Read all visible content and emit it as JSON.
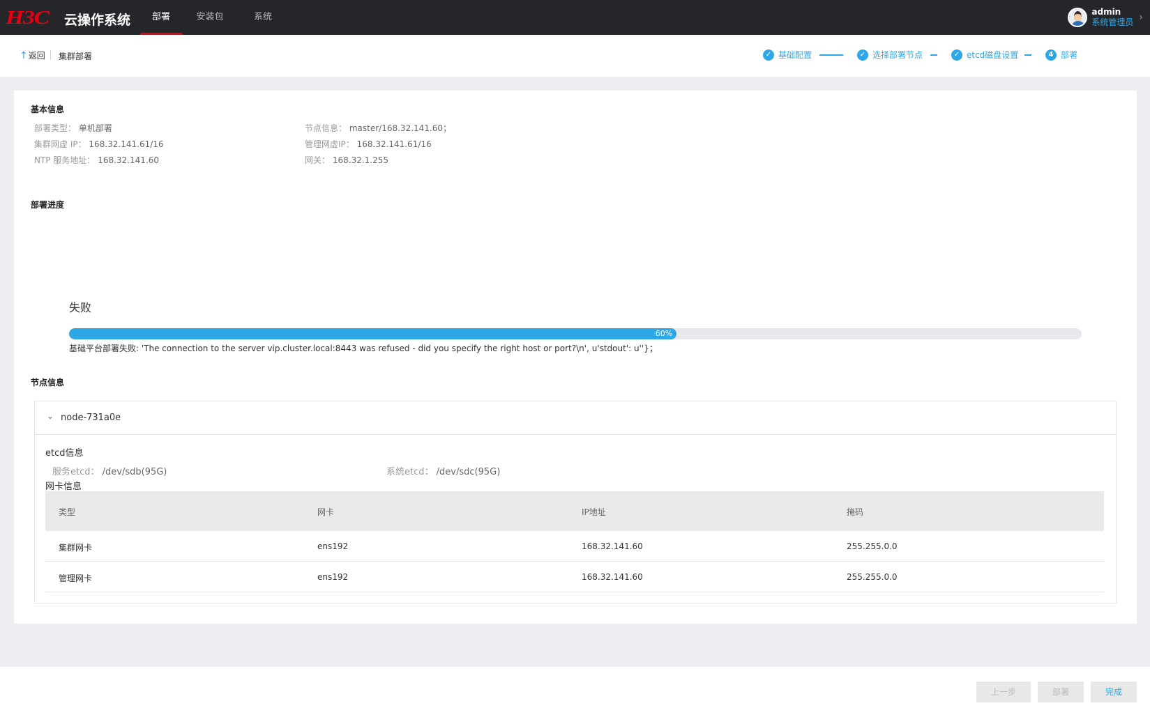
{
  "app": {
    "logo_text": "H3C",
    "product_name": "云操作系统"
  },
  "nav": {
    "tabs": [
      {
        "label": "部署",
        "active": true
      },
      {
        "label": "安装包",
        "active": false
      },
      {
        "label": "系统",
        "active": false
      }
    ]
  },
  "user": {
    "name": "admin",
    "role": "系统管理员"
  },
  "subheader": {
    "back_label": "返回",
    "breadcrumb": "集群部署",
    "steps": [
      {
        "label": "基础配置",
        "status": "done",
        "icon": "check-icon"
      },
      {
        "label": "选择部署节点",
        "status": "done",
        "icon": "check-icon"
      },
      {
        "label": "etcd磁盘设置",
        "status": "done",
        "icon": "check-icon"
      },
      {
        "label": "部署",
        "status": "current",
        "number": "4"
      }
    ]
  },
  "basic_info": {
    "title": "基本信息",
    "deploy_type": {
      "label": "部署类型：",
      "value": "单机部署"
    },
    "cluster_vip": {
      "label": "集群网虚 IP：",
      "value": "168.32.141.61/16"
    },
    "ntp": {
      "label": "NTP 服务地址：",
      "value": "168.32.141.60"
    },
    "node_info": {
      "label": "节点信息：",
      "value": "master/168.32.141.60；"
    },
    "mgmt_vip": {
      "label": "管理网虚IP：",
      "value": "168.32.141.61/16"
    },
    "gateway": {
      "label": "网关：",
      "value": "168.32.1.255"
    }
  },
  "progress": {
    "title": "部署进度",
    "status": "失败",
    "percent": 60,
    "percent_label": "60%",
    "message": "基础平台部署失败: 'The connection to the server vip.cluster.local:8443 was refused - did you specify the right host or port?\\n', u'stdout': u''}；"
  },
  "node_info": {
    "title": "节点信息",
    "node_name": "node-731a0e",
    "etcd_title": "etcd信息",
    "service_etcd": {
      "label": "服务etcd：",
      "value": "/dev/sdb(95G)"
    },
    "system_etcd": {
      "label": "系统etcd：",
      "value": "/dev/sdc(95G)"
    },
    "nic_title": "网卡信息",
    "columns": [
      "类型",
      "网卡",
      "IP地址",
      "掩码"
    ],
    "rows": [
      [
        "集群网卡",
        "ens192",
        "168.32.141.60",
        "255.255.0.0"
      ],
      [
        "管理网卡",
        "ens192",
        "168.32.141.60",
        "255.255.0.0"
      ]
    ]
  },
  "footer": {
    "prev_label": "上一步",
    "deploy_label": "部署",
    "finish_label": "完成"
  },
  "colors": {
    "accent": "#2ea7e6",
    "brand_red": "#e60012",
    "topbar": "#25262a"
  }
}
